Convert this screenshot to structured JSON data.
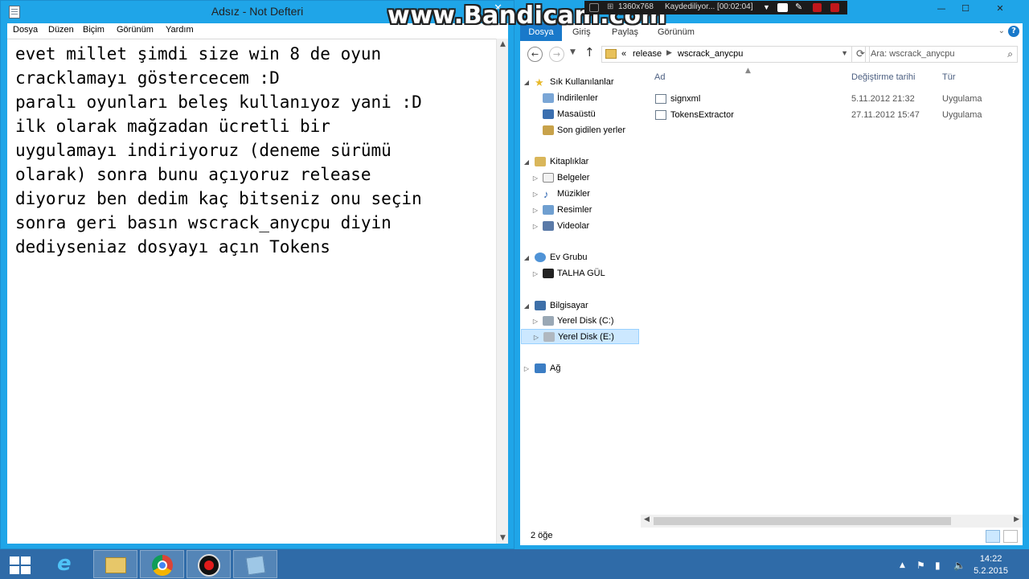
{
  "notepad": {
    "title": "Adsız - Not Defteri",
    "menu": [
      "Dosya",
      "Düzen",
      "Biçim",
      "Görünüm",
      "Yardım"
    ],
    "text": "evet millet şimdi size win 8 de oyun\ncracklamayı göstercecem :D\nparalı oyunları beleş kullanıyoz yani :D\nilk olarak mağzadan ücretli bir\nuygulamayı indiriyoruz (deneme sürümü\nolarak) sonra bunu açıyoruz release\ndiyoruz ben dedim kaç bitseniz onu seçin\nsonra geri basın wscrack_anycpu diyin\ndediyseniaz dosyayı açın Tokens"
  },
  "bandicam": {
    "watermark": "www.Bandicam.com",
    "resolution": "1360x768",
    "status": "Kaydediliyor... [00:02:04]"
  },
  "explorer": {
    "ribbon_tabs": [
      "Dosya",
      "Giriş",
      "Paylaş",
      "Görünüm"
    ],
    "help": "?",
    "address": {
      "prefix": "«",
      "crumbs": [
        "release",
        "wscrack_anycpu"
      ]
    },
    "search_placeholder": "Ara: wscrack_anycpu",
    "nav": {
      "favorites": {
        "label": "Sık Kullanılanlar",
        "items": [
          "İndirilenler",
          "Masaüstü",
          "Son gidilen yerler"
        ]
      },
      "libraries": {
        "label": "Kitaplıklar",
        "items": [
          "Belgeler",
          "Müzikler",
          "Resimler",
          "Videolar"
        ]
      },
      "homegroup": {
        "label": "Ev Grubu",
        "items": [
          "TALHA GÜL"
        ]
      },
      "computer": {
        "label": "Bilgisayar",
        "items": [
          "Yerel Disk (C:)",
          "Yerel Disk (E:)"
        ]
      },
      "network": {
        "label": "Ağ"
      }
    },
    "columns": {
      "name": "Ad",
      "date": "Değiştirme tarihi",
      "type": "Tür"
    },
    "files": [
      {
        "name": "signxml",
        "date": "5.11.2012 21:32",
        "type": "Uygulama"
      },
      {
        "name": "TokensExtractor",
        "date": "27.11.2012 15:47",
        "type": "Uygulama"
      }
    ],
    "status_count": "2 öğe"
  },
  "taskbar": {
    "time": "14:22",
    "date": "5.2.2015"
  },
  "colors": {
    "title_active": "#1fa5e8",
    "ribbon_file_tab": "#1979ca",
    "taskbar": "#2f6ba8",
    "selection": "#cce8ff"
  }
}
